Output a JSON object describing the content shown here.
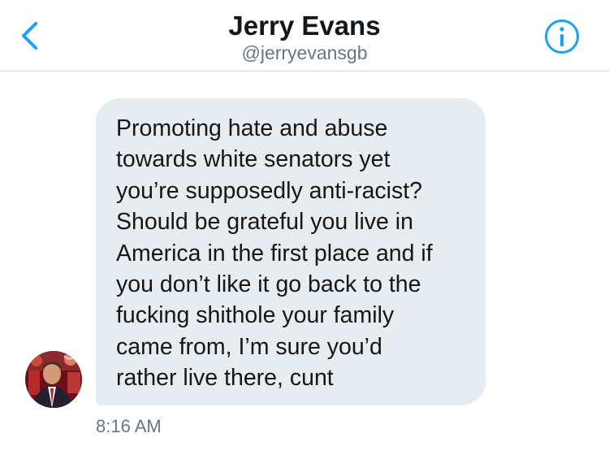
{
  "header": {
    "back_icon": "chevron-left-icon",
    "title": "Jerry Evans",
    "handle": "@jerryevansgb",
    "info_icon": "info-icon",
    "accent_color": "#1da1f2"
  },
  "conversation": {
    "messages": [
      {
        "sender_avatar": "avatar",
        "text": "Promoting hate and abuse\ntowards white senators yet\nyou’re supposedly anti-racist?\nShould be grateful you live in\nAmerica in the first place and if\nyou don’t like it go back to the\nfucking shithole your family\ncame from, I’m sure you’d\nrather live there, cunt",
        "timestamp": "8:16 AM"
      }
    ],
    "bubble_color": "#e6ecf0"
  }
}
